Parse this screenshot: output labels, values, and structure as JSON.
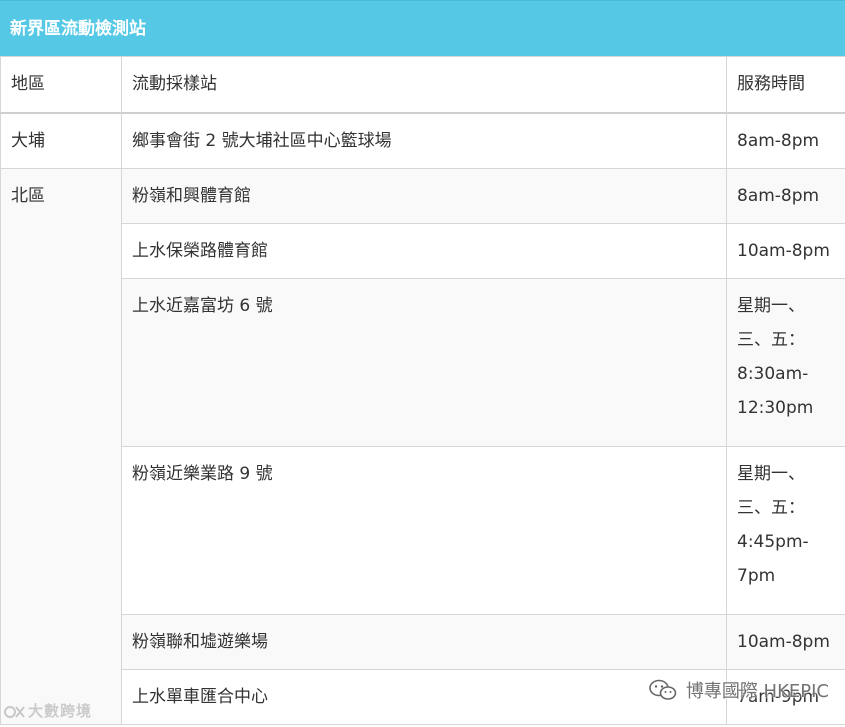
{
  "title": "新界區流動檢測站",
  "headers": {
    "district": "地區",
    "site": "流動採樣站",
    "hours": "服務時間"
  },
  "rows": [
    {
      "district": "大埔",
      "site": "鄉事會街 2 號大埔社區中心籃球場",
      "hours": "8am-8pm"
    },
    {
      "district": "北區",
      "site": "粉嶺和興體育館",
      "hours": "8am-8pm"
    },
    {
      "site": "上水保榮路體育館",
      "hours": "10am-8pm"
    },
    {
      "site": "上水近嘉富坊 6 號",
      "hours_lines": [
        "星期一、",
        "三、五：",
        "8:30am-",
        "12:30pm"
      ]
    },
    {
      "site": "粉嶺近樂業路 9 號",
      "hours_lines": [
        "星期一、",
        "三、五：",
        "4:45pm-",
        "7pm"
      ]
    },
    {
      "site": "粉嶺聯和墟遊樂場",
      "hours": "10am-8pm"
    },
    {
      "site": "上水單車匯合中心",
      "hours": "7am-9pm"
    }
  ],
  "watermarks": {
    "left": "大數跨境",
    "right": "博專國際 HKEPIC"
  },
  "colors": {
    "title_bar": "#55c8e6",
    "title_text": "#ffffff",
    "border": "#d6d6d6",
    "row_shade": "#f9f9f9",
    "body_text": "#333333"
  }
}
